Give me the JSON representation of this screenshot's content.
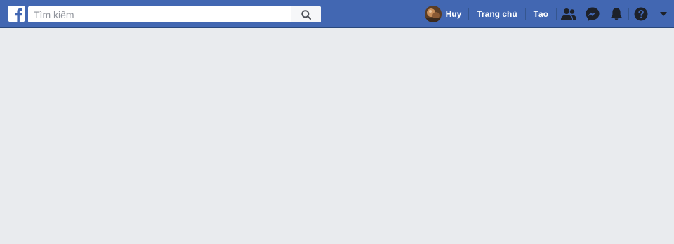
{
  "header": {
    "logo_icon": "facebook-logo-icon",
    "search": {
      "placeholder": "Tìm kiếm",
      "value": "",
      "button_icon": "search-icon"
    },
    "profile": {
      "name": "Huy",
      "avatar_icon": "avatar"
    },
    "nav": {
      "home_label": "Trang chủ",
      "create_label": "Tạo"
    },
    "icons": {
      "friends": "friends-icon",
      "messenger": "messenger-icon",
      "notifications": "bell-icon",
      "help": "help-icon",
      "account_menu": "caret-down-icon"
    },
    "colors": {
      "bar": "#4267b2",
      "page_background": "#e9ebee",
      "icon": "#1d2129"
    }
  }
}
